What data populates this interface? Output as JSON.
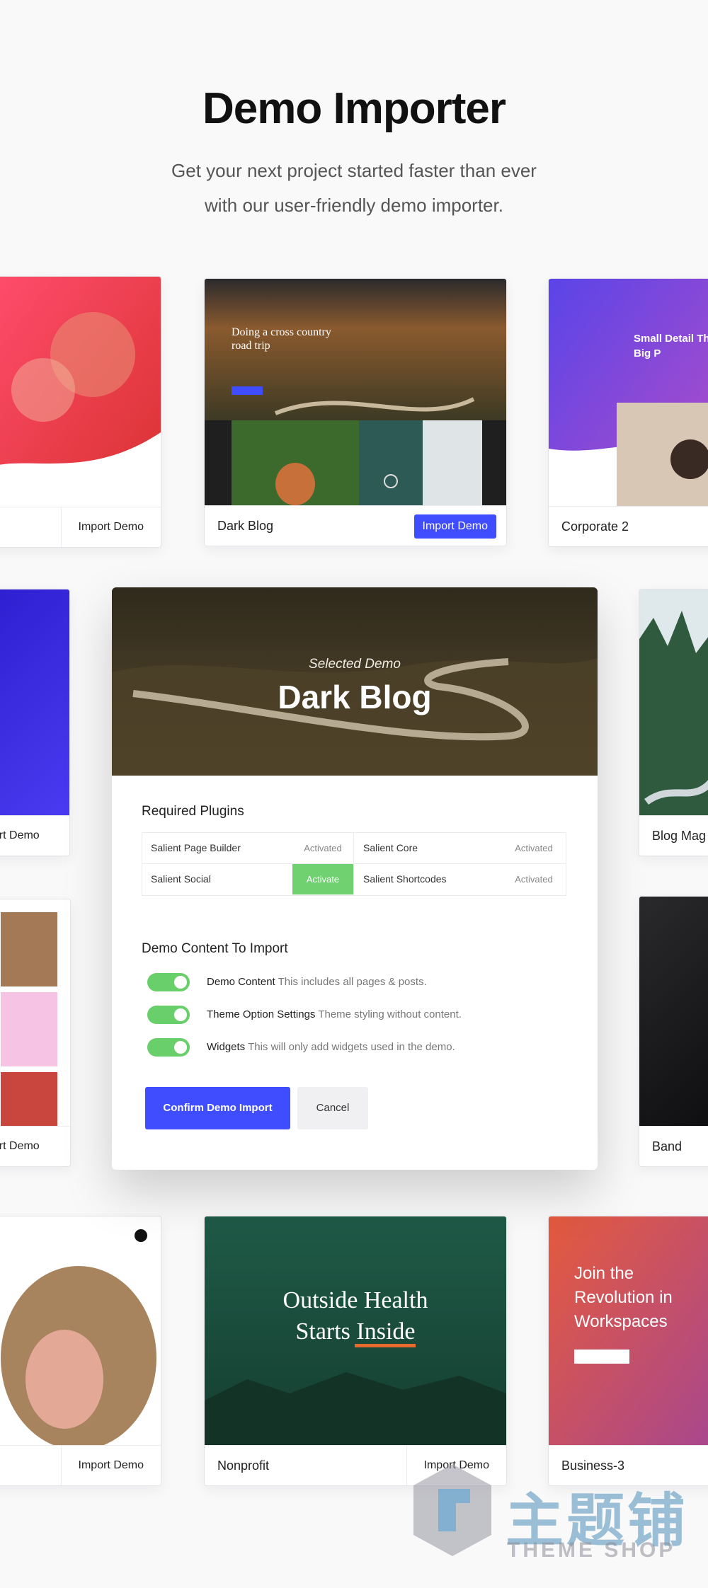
{
  "header": {
    "title": "Demo Importer",
    "subtitle_line1": "Get your next project started faster than ever",
    "subtitle_line2": "with our user-friendly demo importer."
  },
  "cards": {
    "top_left": {
      "import": "Import Demo"
    },
    "dark_blog": {
      "name": "Dark Blog",
      "import": "Import Demo",
      "thumb_heading": "Doing a cross country road trip"
    },
    "corporate2": {
      "name": "Corporate 2",
      "thumb_heading": "Small Detail The Big P"
    },
    "mid_left": {
      "import": "port Demo"
    },
    "blog_mag": {
      "name": "Blog Mag"
    },
    "lower_left": {
      "import": "port Demo"
    },
    "band": {
      "name": "Band"
    },
    "bottom_left": {
      "import": "Import Demo"
    },
    "nonprofit": {
      "name": "Nonprofit",
      "import": "Import Demo",
      "thumb_heading_1": "Outside Health",
      "thumb_heading_2": "Starts Inside"
    },
    "business3": {
      "name": "Business-3",
      "thumb_heading": "Join the Revolution in Workspaces"
    }
  },
  "modal": {
    "kicker": "Selected Demo",
    "title": "Dark Blog",
    "plugins_title": "Required Plugins",
    "plugins": [
      {
        "name": "Salient Page Builder",
        "status": "Activated"
      },
      {
        "name": "Salient Core",
        "status": "Activated"
      },
      {
        "name": "Salient Social",
        "status": "Activate"
      },
      {
        "name": "Salient Shortcodes",
        "status": "Activated"
      }
    ],
    "content_title": "Demo Content To Import",
    "options": [
      {
        "label": "Demo Content",
        "desc": "This includes all pages & posts.",
        "on": true
      },
      {
        "label": "Theme Option Settings",
        "desc": "Theme styling without content.",
        "on": true
      },
      {
        "label": "Widgets",
        "desc": "This will only add widgets used in the demo.",
        "on": true
      }
    ],
    "confirm": "Confirm Demo Import",
    "cancel": "Cancel"
  },
  "watermark": {
    "cn": "主题铺",
    "en": "THEME SHOP"
  },
  "colors": {
    "accent": "#3f4dff",
    "toggle_on": "#68cf6b",
    "activate_bg": "#6fd16f"
  }
}
